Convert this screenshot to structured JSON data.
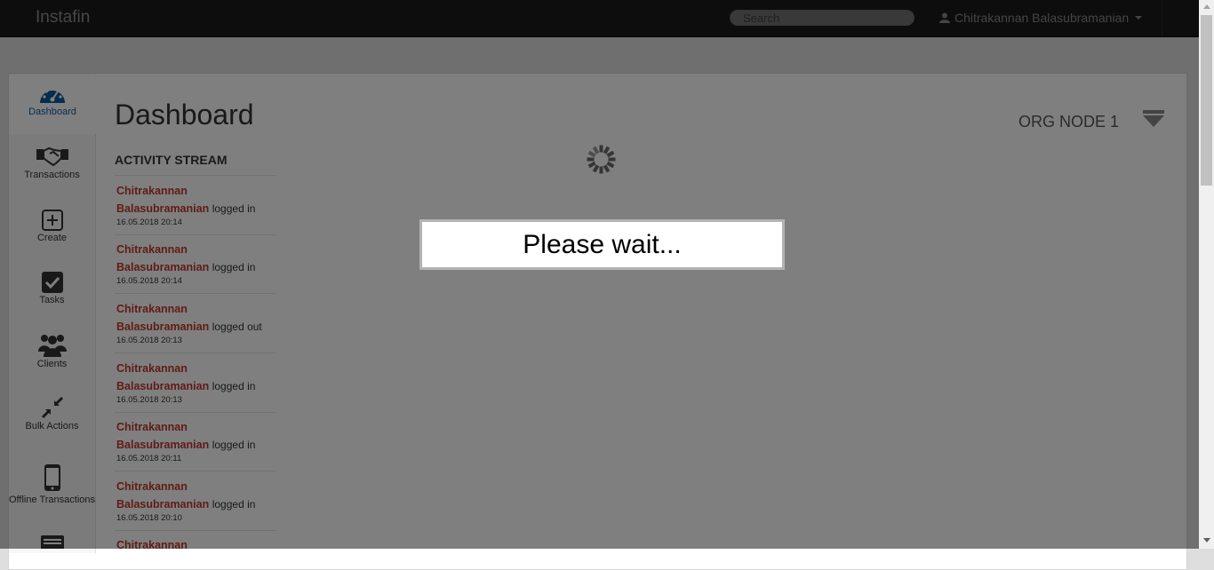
{
  "navbar": {
    "brand": "Instafin",
    "search_placeholder": "Search",
    "user_name": "Chitrakannan Balasubramanian"
  },
  "sidebar": {
    "items": [
      {
        "label": "Dashboard",
        "icon": "dashboard-gauge-icon",
        "active": true
      },
      {
        "label": "Transactions",
        "icon": "handshake-icon"
      },
      {
        "label": "Create",
        "icon": "plus-square-icon"
      },
      {
        "label": "Tasks",
        "icon": "checkbox-icon"
      },
      {
        "label": "Clients",
        "icon": "users-group-icon"
      },
      {
        "label": "Bulk Actions",
        "icon": "compress-arrows-icon"
      },
      {
        "label": "Offline Transactions",
        "icon": "mobile-phone-icon"
      }
    ]
  },
  "main": {
    "title": "Dashboard",
    "org_node": "ORG NODE 1",
    "activity_stream": {
      "heading": "ACTIVITY STREAM",
      "items": [
        {
          "first": "Chitrakannan",
          "last": "Balasubramanian",
          "action": "logged in",
          "time": "16.05.2018 20:14"
        },
        {
          "first": "Chitrakannan",
          "last": "Balasubramanian",
          "action": "logged in",
          "time": "16.05.2018 20:14"
        },
        {
          "first": "Chitrakannan",
          "last": "Balasubramanian",
          "action": "logged out",
          "time": "16.05.2018 20:13"
        },
        {
          "first": "Chitrakannan",
          "last": "Balasubramanian",
          "action": "logged in",
          "time": "16.05.2018 20:13"
        },
        {
          "first": "Chitrakannan",
          "last": "Balasubramanian",
          "action": "logged in",
          "time": "16.05.2018 20:11"
        },
        {
          "first": "Chitrakannan",
          "last": "Balasubramanian",
          "action": "logged in",
          "time": "16.05.2018 20:10"
        },
        {
          "first": "Chitrakannan",
          "last": "",
          "action": "",
          "time": ""
        }
      ]
    }
  },
  "overlay": {
    "message": "Please wait..."
  },
  "colors": {
    "navbar_bg": "#1a1a1a",
    "accent_blue": "#0d5a9e",
    "link_red": "#c0392b"
  }
}
